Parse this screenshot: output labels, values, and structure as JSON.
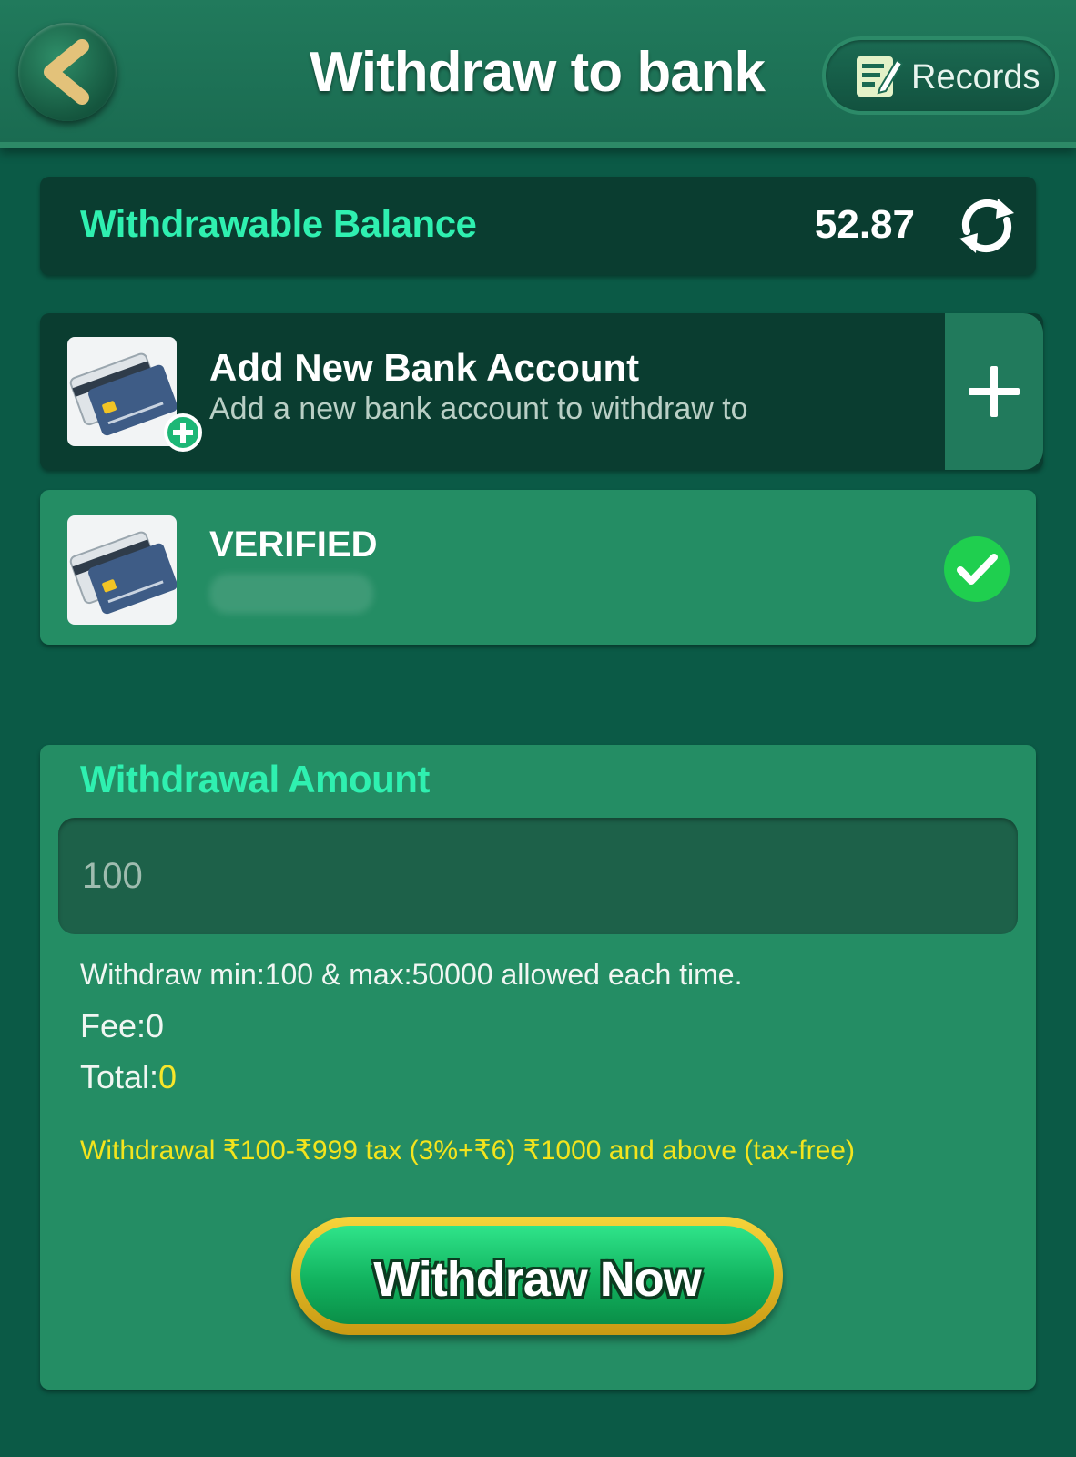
{
  "header": {
    "title": "Withdraw to bank",
    "back_icon": "back-chevron-icon",
    "records_label": "Records",
    "records_icon": "records-notepad-icon"
  },
  "balance": {
    "label": "Withdrawable Balance",
    "value": "52.87",
    "refresh_icon": "refresh-icon"
  },
  "add_bank": {
    "title": "Add New Bank Account",
    "subtitle": "Add a new bank account to withdraw to",
    "icon": "bank-card-icon",
    "add_icon": "plus-icon"
  },
  "bank_account": {
    "status": "VERIFIED",
    "icon": "bank-card-icon",
    "check_icon": "check-circle-icon"
  },
  "withdrawal": {
    "title": "Withdrawal Amount",
    "amount_placeholder": "100",
    "limits_text": "Withdraw min:100 & max:50000 allowed each time.",
    "fee_label": "Fee:",
    "fee_value": "0",
    "total_label": "Total:",
    "total_value": "0",
    "tax_note": "Withdrawal ₹100-₹999 tax (3%+₹6) ₹1000 and above (tax-free)",
    "button_label": "Withdraw Now"
  },
  "colors": {
    "background": "#0b5a46",
    "accent_mint": "#2ff0b0",
    "tax_yellow": "#f3e41d",
    "button_gold": "#f6d43a",
    "button_green": "#12b35f"
  }
}
